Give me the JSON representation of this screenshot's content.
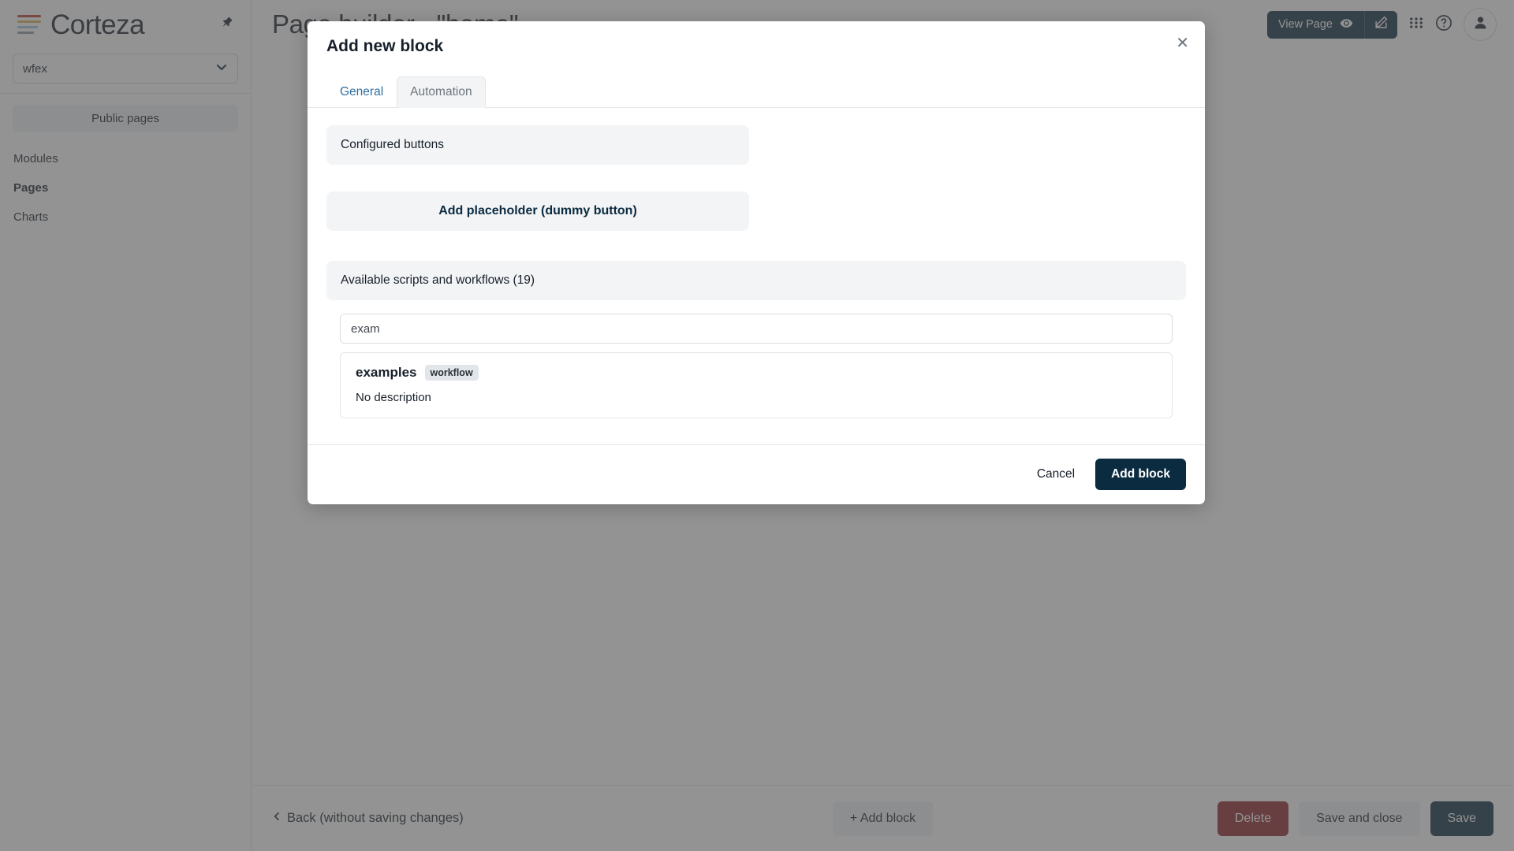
{
  "sidebar": {
    "brand": "Corteza",
    "pin_icon": "pin-icon",
    "namespace": {
      "value": "wfex",
      "chevron": "chevron-down-icon"
    },
    "public_pages_label": "Public pages",
    "items": [
      {
        "label": "Modules",
        "active": false
      },
      {
        "label": "Pages",
        "active": true
      },
      {
        "label": "Charts",
        "active": false
      }
    ]
  },
  "topbar": {
    "page_title": "Page builder - \"home\"",
    "view_page_label": "View Page",
    "view_page_icon": "eye-icon",
    "edit_icon": "pencil-square-icon",
    "apps_icon": "grid-apps-icon",
    "help_icon": "question-circle-icon",
    "avatar_icon": "user-icon"
  },
  "bottombar": {
    "back_label": "Back (without saving changes)",
    "back_icon": "chevron-left-icon",
    "add_block_label": "+ Add block",
    "delete_label": "Delete",
    "save_and_close_label": "Save and close",
    "save_label": "Save"
  },
  "modal": {
    "title": "Add new block",
    "close_icon": "close-icon",
    "tabs": [
      {
        "label": "General",
        "active": false
      },
      {
        "label": "Automation",
        "active": true
      }
    ],
    "configured_buttons_label": "Configured buttons",
    "add_placeholder_label": "Add placeholder (dummy button)",
    "available_label": "Available scripts and workflows (19)",
    "search": {
      "value": "exam",
      "placeholder": ""
    },
    "results": [
      {
        "name": "examples",
        "badge": "workflow",
        "description": "No description"
      }
    ],
    "cancel_label": "Cancel",
    "add_block_label": "Add block"
  },
  "colors": {
    "brand_dark": "#0b2b40",
    "danger": "#8b2226",
    "panel_bg": "#f3f4f6",
    "badge_bg": "#e2e6ea",
    "link_blue": "#2f6f9f"
  }
}
